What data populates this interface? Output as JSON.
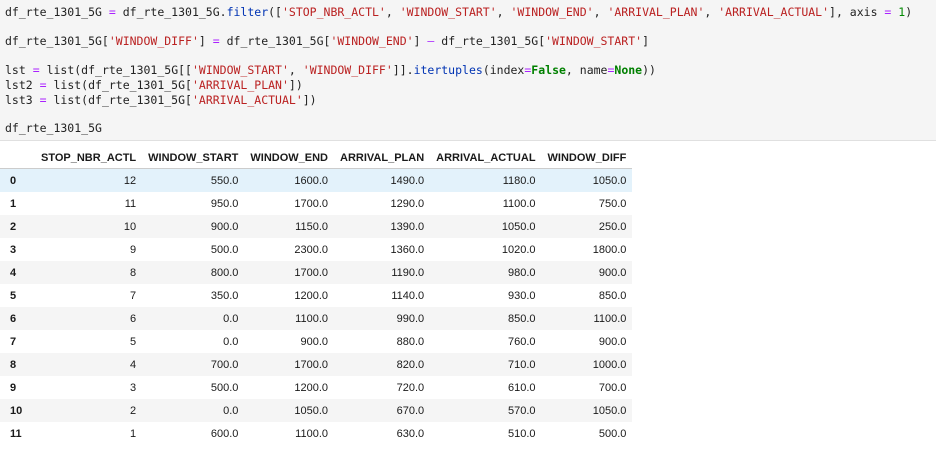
{
  "code": {
    "line1": {
      "var": "df_rte_1301_5G",
      "eq": " = ",
      "var2": "df_rte_1301_5G.",
      "fn": "filter",
      "open": "([",
      "s1": "'STOP_NBR_ACTL'",
      "s2": "'WINDOW_START'",
      "s3": "'WINDOW_END'",
      "s4": "'ARRIVAL_PLAN'",
      "s5": "'ARRIVAL_ACTUAL'",
      "sep": ", ",
      "close_axis": "], axis ",
      "eq2": "=",
      "num": " 1",
      "close": ")"
    },
    "line2": {
      "a": "df_rte_1301_5G[",
      "s1": "'WINDOW_DIFF'",
      "b": "] ",
      "eq": "=",
      "c": " df_rte_1301_5G[",
      "s2": "'WINDOW_END'",
      "d": "] ",
      "minus": "–",
      "e": " df_rte_1301_5G[",
      "s3": "'WINDOW_START'",
      "f": "]"
    },
    "line3": {
      "a": "lst ",
      "eq": "=",
      "b": " list(df_rte_1301_5G[[",
      "s1": "'WINDOW_START'",
      "sep": ", ",
      "s2": "'WINDOW_DIFF'",
      "c": "]].",
      "fn": "itertuples",
      "d": "(index",
      "eq2": "=",
      "kw1": "False",
      "e": ", name",
      "eq3": "=",
      "kw2": "None",
      "f": "))"
    },
    "line4": {
      "a": "lst2 ",
      "eq": "=",
      "b": " list(df_rte_1301_5G[",
      "s1": "'ARRIVAL_PLAN'",
      "c": "])"
    },
    "line5": {
      "a": "lst3 ",
      "eq": "=",
      "b": " list(df_rte_1301_5G[",
      "s1": "'ARRIVAL_ACTUAL'",
      "c": "])"
    },
    "line6": "df_rte_1301_5G"
  },
  "table": {
    "columns": [
      "STOP_NBR_ACTL",
      "WINDOW_START",
      "WINDOW_END",
      "ARRIVAL_PLAN",
      "ARRIVAL_ACTUAL",
      "WINDOW_DIFF"
    ],
    "rows": [
      {
        "idx": "0",
        "cells": [
          "12",
          "550.0",
          "1600.0",
          "1490.0",
          "1180.0",
          "1050.0"
        ]
      },
      {
        "idx": "1",
        "cells": [
          "11",
          "950.0",
          "1700.0",
          "1290.0",
          "1100.0",
          "750.0"
        ]
      },
      {
        "idx": "2",
        "cells": [
          "10",
          "900.0",
          "1150.0",
          "1390.0",
          "1050.0",
          "250.0"
        ]
      },
      {
        "idx": "3",
        "cells": [
          "9",
          "500.0",
          "2300.0",
          "1360.0",
          "1020.0",
          "1800.0"
        ]
      },
      {
        "idx": "4",
        "cells": [
          "8",
          "800.0",
          "1700.0",
          "1190.0",
          "980.0",
          "900.0"
        ]
      },
      {
        "idx": "5",
        "cells": [
          "7",
          "350.0",
          "1200.0",
          "1140.0",
          "930.0",
          "850.0"
        ]
      },
      {
        "idx": "6",
        "cells": [
          "6",
          "0.0",
          "1100.0",
          "990.0",
          "850.0",
          "1100.0"
        ]
      },
      {
        "idx": "7",
        "cells": [
          "5",
          "0.0",
          "900.0",
          "880.0",
          "760.0",
          "900.0"
        ]
      },
      {
        "idx": "8",
        "cells": [
          "4",
          "700.0",
          "1700.0",
          "820.0",
          "710.0",
          "1000.0"
        ]
      },
      {
        "idx": "9",
        "cells": [
          "3",
          "500.0",
          "1200.0",
          "720.0",
          "610.0",
          "700.0"
        ]
      },
      {
        "idx": "10",
        "cells": [
          "2",
          "0.0",
          "1050.0",
          "670.0",
          "570.0",
          "1050.0"
        ]
      },
      {
        "idx": "11",
        "cells": [
          "1",
          "600.0",
          "1100.0",
          "630.0",
          "510.0",
          "500.0"
        ]
      }
    ],
    "highlighted_row": "0"
  }
}
